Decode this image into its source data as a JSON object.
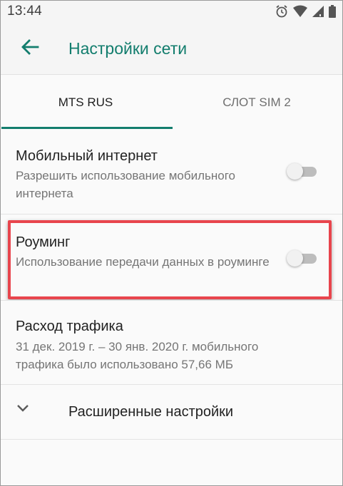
{
  "status_bar": {
    "time": "13:44",
    "icons": [
      "alarm-icon",
      "wifi-icon",
      "signal-icon",
      "battery-icon"
    ]
  },
  "app_bar": {
    "back_icon": "arrow-left-icon",
    "title": "Настройки сети"
  },
  "tabs": [
    {
      "label": "MTS RUS",
      "selected": true
    },
    {
      "label": "СЛОТ SIM 2",
      "selected": false
    }
  ],
  "settings": {
    "mobile_internet": {
      "title": "Мобильный интернет",
      "subtitle": "Разрешить использование мобильного интернета",
      "enabled": false
    },
    "roaming": {
      "title": "Роуминг",
      "subtitle": "Использование передачи данных в роуминге",
      "enabled": false
    },
    "traffic": {
      "title": "Расход трафика",
      "subtitle": "31 дек. 2019 г. – 30 янв. 2020 г. мобильного трафика было использовано 57,66 МБ"
    },
    "advanced": {
      "icon": "chevron-down-icon",
      "label": "Расширенные настройки"
    }
  },
  "colors": {
    "accent": "#127d6d",
    "highlight": "#e8454d",
    "background": "#fafafa"
  }
}
